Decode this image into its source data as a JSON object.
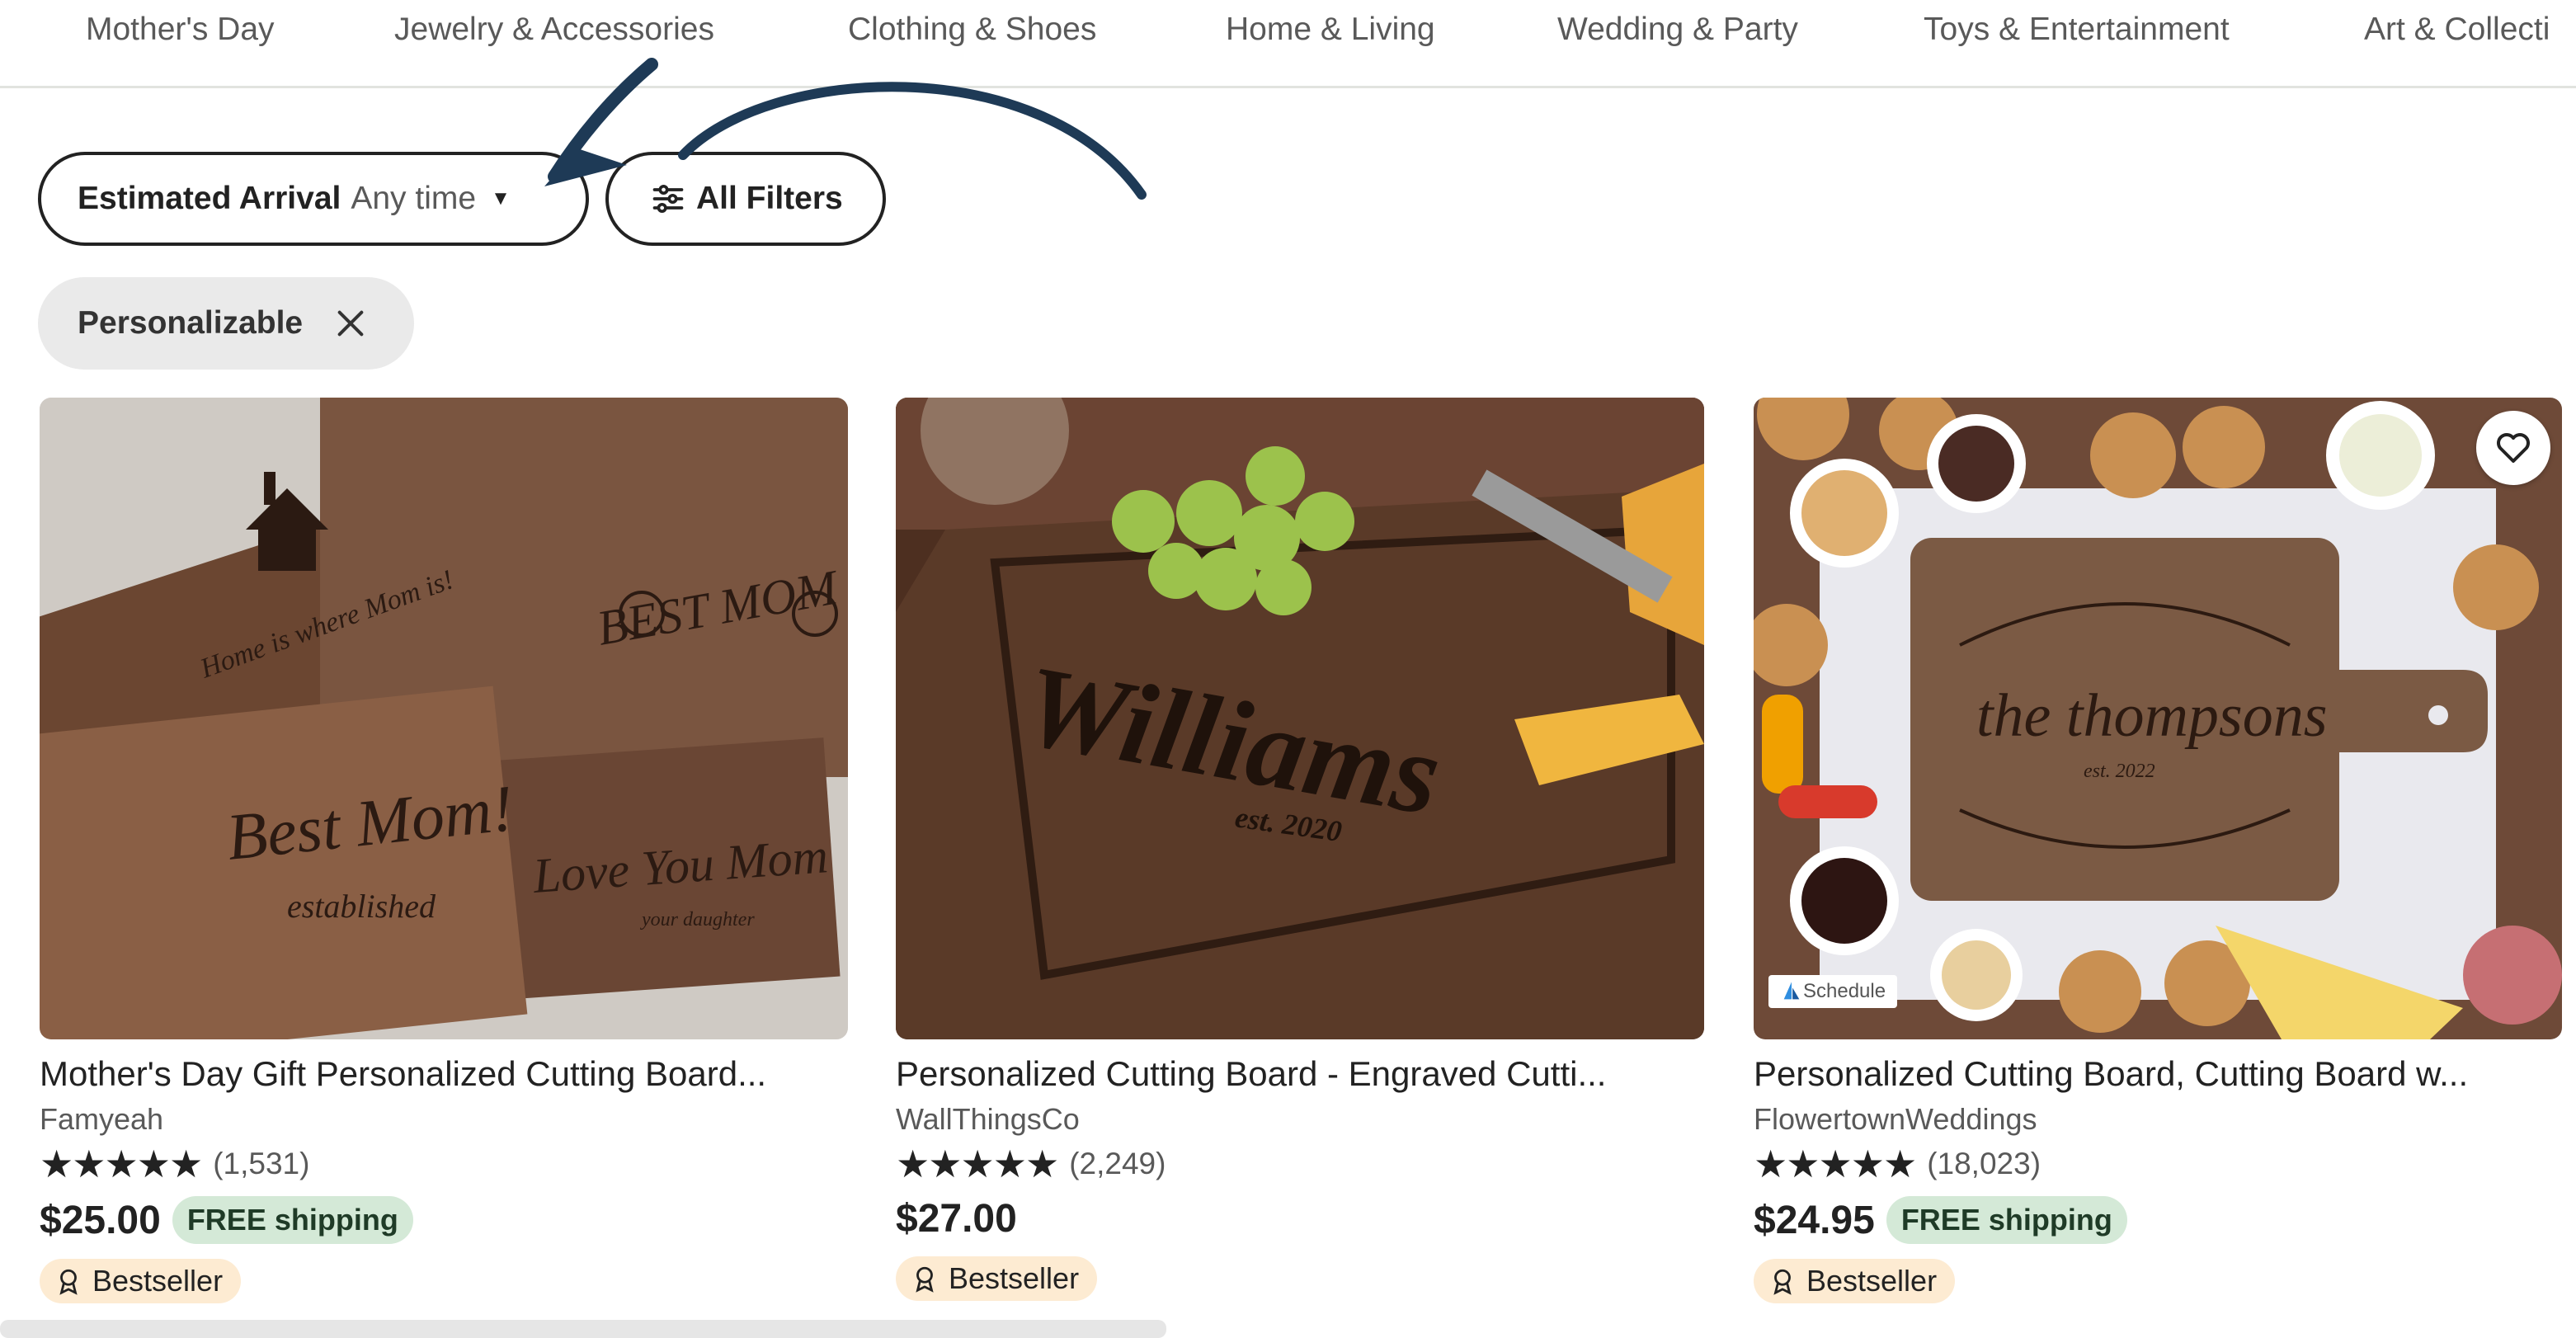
{
  "nav": {
    "categories": [
      "Mother's Day",
      "Jewelry & Accessories",
      "Clothing & Shoes",
      "Home & Living",
      "Wedding & Party",
      "Toys & Entertainment",
      "Art & Collecti"
    ]
  },
  "filters": {
    "arrival_label": "Estimated Arrival",
    "arrival_value": "Any time",
    "all_filters": "All Filters",
    "active_chip": "Personalizable"
  },
  "products": [
    {
      "title": "Mother's Day Gift Personalized Cutting Board...",
      "shop": "Famyeah",
      "stars": "★★★★★",
      "reviews": "(1,531)",
      "price": "$25.00",
      "shipping": "FREE shipping",
      "badge": "Bestseller",
      "image_text": [
        "Home is where Mom is!",
        "BEST MOM",
        "Best Mom!",
        "established",
        "Love You Mom",
        "your daughter"
      ]
    },
    {
      "title": "Personalized Cutting Board - Engraved Cutti...",
      "shop": "WallThingsCo",
      "stars": "★★★★★",
      "reviews": "(2,249)",
      "price": "$27.00",
      "shipping": "",
      "badge": "Bestseller",
      "image_text": [
        "Williams",
        "est. 2020"
      ]
    },
    {
      "title": "Personalized Cutting Board, Cutting Board w...",
      "shop": "FlowertownWeddings",
      "stars": "★★★★★",
      "reviews": "(18,023)",
      "price": "$24.95",
      "shipping": "FREE shipping",
      "badge": "Bestseller",
      "image_text": [
        "the thompsons",
        "est. 2022"
      ],
      "overlay_label": "Schedule"
    }
  ],
  "colors": {
    "accent_arrow": "#1e3a56",
    "shipping_bg": "#d4e9d7",
    "badge_bg": "#fdebd2",
    "wood_dark": "#5a3d2b"
  }
}
